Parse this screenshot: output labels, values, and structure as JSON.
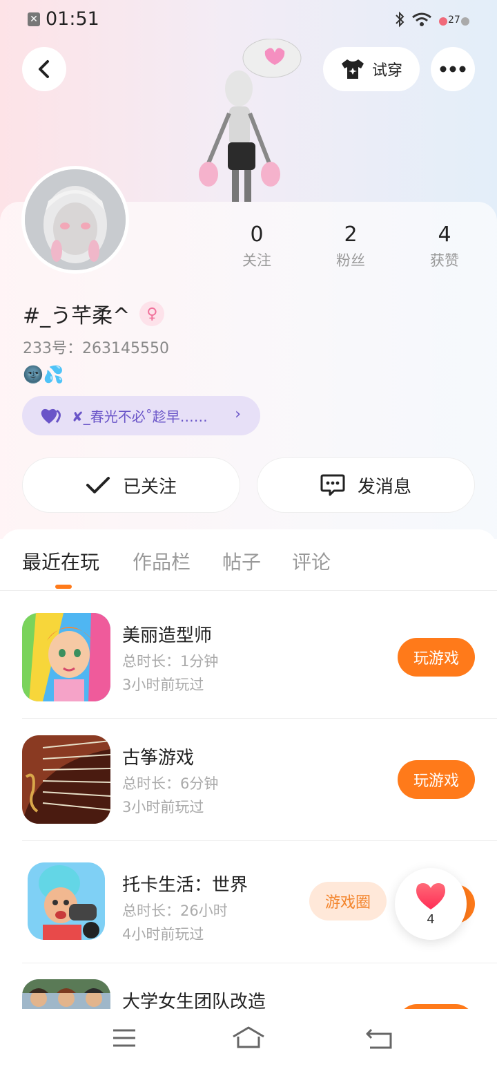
{
  "status_bar": {
    "time": "01:51",
    "battery": "27"
  },
  "header": {
    "try_on_label": "试穿"
  },
  "profile": {
    "following_count": "0",
    "following_label": "关注",
    "followers_count": "2",
    "followers_label": "粉丝",
    "likes_count": "4",
    "likes_label": "获赞",
    "name": "#_う芊柔^",
    "uid": "233号：263145550",
    "emoji": "🌚💦",
    "tag_text": "✘_春光不必˚趁早……"
  },
  "actions": {
    "followed_label": "已关注",
    "message_label": "发消息"
  },
  "tabs": [
    "最近在玩",
    "作品栏",
    "帖子",
    "评论"
  ],
  "games": [
    {
      "name": "美丽造型师",
      "duration": "总时长：1分钟",
      "last_played": "3小时前玩过",
      "button": "玩游戏"
    },
    {
      "name": "古筝游戏",
      "duration": "总时长：6分钟",
      "last_played": "3小时前玩过",
      "button": "玩游戏"
    },
    {
      "name": "托卡生活：世界",
      "duration": "总时长：26小时",
      "last_played": "4小时前玩过",
      "button": "",
      "circle_button": "游戏圈"
    },
    {
      "name": "大学女生团队改造",
      "duration": "",
      "last_played": "",
      "button": ""
    }
  ],
  "float_like": {
    "count": "4"
  },
  "colors": {
    "accent": "#ff7a1a",
    "tag_bg": "#e7e0f7",
    "tag_text": "#6a55c8"
  }
}
